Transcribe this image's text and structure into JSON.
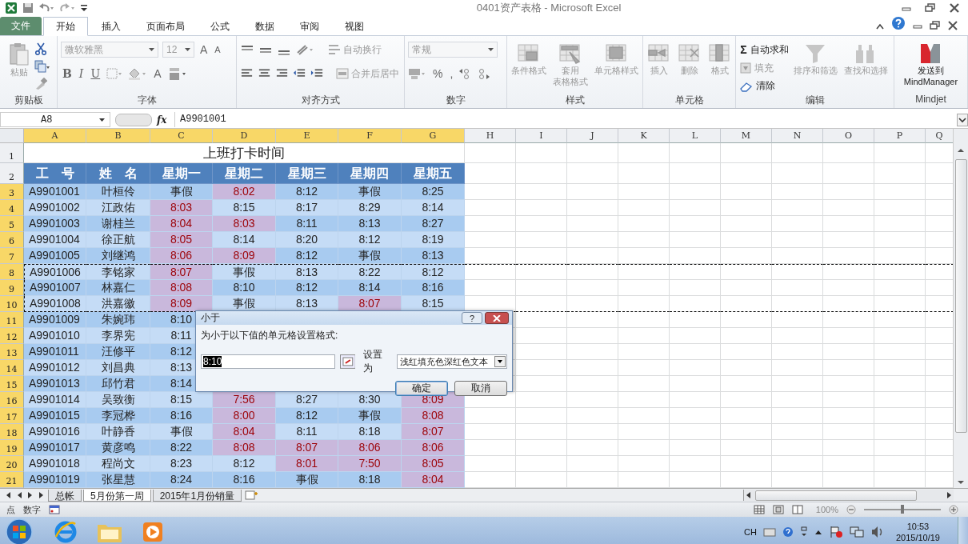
{
  "window": {
    "title": "0401资产表格 - Microsoft Excel"
  },
  "tabs": [
    {
      "label": "文件",
      "kind": "file",
      "selected": false
    },
    {
      "label": "开始",
      "kind": "tab",
      "selected": true
    },
    {
      "label": "插入",
      "kind": "tab",
      "selected": false
    },
    {
      "label": "页面布局",
      "kind": "tab",
      "selected": false
    },
    {
      "label": "公式",
      "kind": "tab",
      "selected": false
    },
    {
      "label": "数据",
      "kind": "tab",
      "selected": false
    },
    {
      "label": "审阅",
      "kind": "tab",
      "selected": false
    },
    {
      "label": "视图",
      "kind": "tab",
      "selected": false
    }
  ],
  "ribbon": {
    "clipboard": {
      "label": "剪贴板",
      "paste": "粘贴"
    },
    "font": {
      "label": "字体",
      "font_name": "微软雅黑",
      "font_size": "12",
      "grow": "A",
      "shrink": "A",
      "bold": "B",
      "italic": "I",
      "underline": "U",
      "font_color": "A"
    },
    "alignment": {
      "label": "对齐方式",
      "wrap": "自动换行",
      "merge": "合并后居中"
    },
    "number": {
      "label": "数字",
      "format": "常规",
      "percent": "%",
      "comma": ","
    },
    "styles": {
      "label": "样式",
      "buttons": [
        {
          "lines": [
            "条件格式"
          ],
          "kind": "conditional",
          "disabled": true
        },
        {
          "lines": [
            "套用",
            "表格格式"
          ],
          "kind": "table",
          "disabled": true
        },
        {
          "lines": [
            "单元格样式"
          ],
          "kind": "cellstyle",
          "disabled": true
        }
      ]
    },
    "cells": {
      "label": "单元格",
      "buttons": [
        {
          "lines": [
            "插入"
          ],
          "kind": "insert",
          "disabled": true
        },
        {
          "lines": [
            "删除"
          ],
          "kind": "delete",
          "disabled": true
        },
        {
          "lines": [
            "格式"
          ],
          "kind": "format",
          "disabled": true
        }
      ]
    },
    "editing": {
      "label": "编辑",
      "small": [
        {
          "kind": "sum",
          "symbol": "Σ",
          "label": "自动求和",
          "disabled": false
        },
        {
          "kind": "fill",
          "label": "填充",
          "disabled": true
        },
        {
          "kind": "clear",
          "label": "清除",
          "disabled": false
        }
      ],
      "buttons": [
        {
          "lines": [
            "排序和筛选"
          ],
          "kind": "sort",
          "disabled": true
        },
        {
          "lines": [
            "查找和选择"
          ],
          "kind": "find",
          "disabled": true
        }
      ]
    },
    "mindjet": {
      "label": "Mindjet",
      "lines": [
        "发送到",
        "MindManager"
      ]
    }
  },
  "formula_bar": {
    "name_box": "A8",
    "fx": "fx",
    "formula": "A9901001"
  },
  "sheet": {
    "columns": [
      {
        "label": "A",
        "selected": true
      },
      {
        "label": "B",
        "selected": true
      },
      {
        "label": "C",
        "selected": true
      },
      {
        "label": "D",
        "selected": true
      },
      {
        "label": "E",
        "selected": true
      },
      {
        "label": "F",
        "selected": true
      },
      {
        "label": "G",
        "selected": true
      },
      {
        "label": "H",
        "selected": false
      },
      {
        "label": "I",
        "selected": false
      },
      {
        "label": "J",
        "selected": false
      },
      {
        "label": "K",
        "selected": false
      },
      {
        "label": "L",
        "selected": false
      },
      {
        "label": "M",
        "selected": false
      },
      {
        "label": "N",
        "selected": false
      },
      {
        "label": "O",
        "selected": false
      },
      {
        "label": "P",
        "selected": false
      },
      {
        "label": "Q",
        "selected": false
      }
    ],
    "title_row": {
      "number": "1",
      "selected": false,
      "text": "上班打卡时间"
    },
    "header_row": {
      "number": "2",
      "selected": false,
      "cells": [
        "工　号",
        "姓　名",
        "星期一",
        "星期二",
        "星期三",
        "星期四",
        "星期五"
      ]
    },
    "rows": [
      {
        "number": "3",
        "selected": true,
        "marquee": false,
        "cells": [
          {
            "text": "A9901001",
            "highlighted": false
          },
          {
            "text": "叶桓伶",
            "highlighted": false
          },
          {
            "text": "事假",
            "highlighted": false
          },
          {
            "text": "8:02",
            "highlighted": true
          },
          {
            "text": "8:12",
            "highlighted": false
          },
          {
            "text": "事假",
            "highlighted": false
          },
          {
            "text": "8:25",
            "highlighted": false
          }
        ]
      },
      {
        "number": "4",
        "selected": true,
        "marquee": false,
        "cells": [
          {
            "text": "A9901002",
            "highlighted": false
          },
          {
            "text": "江政佑",
            "highlighted": false
          },
          {
            "text": "8:03",
            "highlighted": true
          },
          {
            "text": "8:15",
            "highlighted": false
          },
          {
            "text": "8:17",
            "highlighted": false
          },
          {
            "text": "8:29",
            "highlighted": false
          },
          {
            "text": "8:14",
            "highlighted": false
          }
        ]
      },
      {
        "number": "5",
        "selected": true,
        "marquee": false,
        "cells": [
          {
            "text": "A9901003",
            "highlighted": false
          },
          {
            "text": "谢桂兰",
            "highlighted": false
          },
          {
            "text": "8:04",
            "highlighted": true
          },
          {
            "text": "8:03",
            "highlighted": true
          },
          {
            "text": "8:11",
            "highlighted": false
          },
          {
            "text": "8:13",
            "highlighted": false
          },
          {
            "text": "8:27",
            "highlighted": false
          }
        ]
      },
      {
        "number": "6",
        "selected": true,
        "marquee": false,
        "cells": [
          {
            "text": "A9901004",
            "highlighted": false
          },
          {
            "text": "徐正航",
            "highlighted": false
          },
          {
            "text": "8:05",
            "highlighted": true
          },
          {
            "text": "8:14",
            "highlighted": false
          },
          {
            "text": "8:20",
            "highlighted": false
          },
          {
            "text": "8:12",
            "highlighted": false
          },
          {
            "text": "8:19",
            "highlighted": false
          }
        ]
      },
      {
        "number": "7",
        "selected": true,
        "marquee": false,
        "cells": [
          {
            "text": "A9901005",
            "highlighted": false
          },
          {
            "text": "刘继鸿",
            "highlighted": false
          },
          {
            "text": "8:06",
            "highlighted": true
          },
          {
            "text": "8:09",
            "highlighted": true
          },
          {
            "text": "8:12",
            "highlighted": false
          },
          {
            "text": "事假",
            "highlighted": false
          },
          {
            "text": "8:13",
            "highlighted": false
          }
        ]
      },
      {
        "number": "8",
        "selected": true,
        "marquee": true,
        "cells": [
          {
            "text": "A9901006",
            "highlighted": false
          },
          {
            "text": "李铭家",
            "highlighted": false
          },
          {
            "text": "8:07",
            "highlighted": true
          },
          {
            "text": "事假",
            "highlighted": false
          },
          {
            "text": "8:13",
            "highlighted": false
          },
          {
            "text": "8:22",
            "highlighted": false
          },
          {
            "text": "8:12",
            "highlighted": false
          }
        ]
      },
      {
        "number": "9",
        "selected": true,
        "marquee": true,
        "cells": [
          {
            "text": "A9901007",
            "highlighted": false
          },
          {
            "text": "林嘉仁",
            "highlighted": false
          },
          {
            "text": "8:08",
            "highlighted": true
          },
          {
            "text": "8:10",
            "highlighted": false
          },
          {
            "text": "8:12",
            "highlighted": false
          },
          {
            "text": "8:14",
            "highlighted": false
          },
          {
            "text": "8:16",
            "highlighted": false
          }
        ]
      },
      {
        "number": "10",
        "selected": true,
        "marquee": true,
        "cells": [
          {
            "text": "A9901008",
            "highlighted": false
          },
          {
            "text": "洪嘉徽",
            "highlighted": false
          },
          {
            "text": "8:09",
            "highlighted": true
          },
          {
            "text": "事假",
            "highlighted": false
          },
          {
            "text": "8:13",
            "highlighted": false
          },
          {
            "text": "8:07",
            "highlighted": true
          },
          {
            "text": "8:15",
            "highlighted": false
          }
        ]
      },
      {
        "number": "11",
        "selected": true,
        "marquee": false,
        "cells": [
          {
            "text": "A9901009",
            "highlighted": false
          },
          {
            "text": "朱婉玮",
            "highlighted": false
          },
          {
            "text": "8:10",
            "highlighted": false
          }
        ]
      },
      {
        "number": "12",
        "selected": true,
        "marquee": false,
        "cells": [
          {
            "text": "A9901010",
            "highlighted": false
          },
          {
            "text": "李界宪",
            "highlighted": false
          },
          {
            "text": "8:11",
            "highlighted": false
          }
        ]
      },
      {
        "number": "13",
        "selected": true,
        "marquee": false,
        "cells": [
          {
            "text": "A9901011",
            "highlighted": false
          },
          {
            "text": "汪修平",
            "highlighted": false
          },
          {
            "text": "8:12",
            "highlighted": false
          }
        ]
      },
      {
        "number": "14",
        "selected": true,
        "marquee": false,
        "cells": [
          {
            "text": "A9901012",
            "highlighted": false
          },
          {
            "text": "刘昌典",
            "highlighted": false
          },
          {
            "text": "8:13",
            "highlighted": false
          }
        ]
      },
      {
        "number": "15",
        "selected": true,
        "marquee": false,
        "cells": [
          {
            "text": "A9901013",
            "highlighted": false
          },
          {
            "text": "邱竹君",
            "highlighted": false
          },
          {
            "text": "8:14",
            "highlighted": false
          }
        ]
      },
      {
        "number": "16",
        "selected": true,
        "marquee": false,
        "cells": [
          {
            "text": "A9901014",
            "highlighted": false
          },
          {
            "text": "吴致衡",
            "highlighted": false
          },
          {
            "text": "8:15",
            "highlighted": false
          },
          {
            "text": "7:56",
            "highlighted": true
          },
          {
            "text": "8:27",
            "highlighted": false
          },
          {
            "text": "8:30",
            "highlighted": false
          },
          {
            "text": "8:09",
            "highlighted": true
          }
        ]
      },
      {
        "number": "17",
        "selected": true,
        "marquee": false,
        "cells": [
          {
            "text": "A9901015",
            "highlighted": false
          },
          {
            "text": "李冠桦",
            "highlighted": false
          },
          {
            "text": "8:16",
            "highlighted": false
          },
          {
            "text": "8:00",
            "highlighted": true
          },
          {
            "text": "8:12",
            "highlighted": false
          },
          {
            "text": "事假",
            "highlighted": false
          },
          {
            "text": "8:08",
            "highlighted": true
          }
        ]
      },
      {
        "number": "18",
        "selected": true,
        "marquee": false,
        "cells": [
          {
            "text": "A9901016",
            "highlighted": false
          },
          {
            "text": "叶静香",
            "highlighted": false
          },
          {
            "text": "事假",
            "highlighted": false
          },
          {
            "text": "8:04",
            "highlighted": true
          },
          {
            "text": "8:11",
            "highlighted": false
          },
          {
            "text": "8:18",
            "highlighted": false
          },
          {
            "text": "8:07",
            "highlighted": true
          }
        ]
      },
      {
        "number": "19",
        "selected": true,
        "marquee": false,
        "cells": [
          {
            "text": "A9901017",
            "highlighted": false
          },
          {
            "text": "黄彦鸣",
            "highlighted": false
          },
          {
            "text": "8:22",
            "highlighted": false
          },
          {
            "text": "8:08",
            "highlighted": true
          },
          {
            "text": "8:07",
            "highlighted": true
          },
          {
            "text": "8:06",
            "highlighted": true
          },
          {
            "text": "8:06",
            "highlighted": true
          }
        ]
      },
      {
        "number": "20",
        "selected": true,
        "marquee": false,
        "cells": [
          {
            "text": "A9901018",
            "highlighted": false
          },
          {
            "text": "程尚文",
            "highlighted": false
          },
          {
            "text": "8:23",
            "highlighted": false
          },
          {
            "text": "8:12",
            "highlighted": false
          },
          {
            "text": "8:01",
            "highlighted": true
          },
          {
            "text": "7:50",
            "highlighted": true
          },
          {
            "text": "8:05",
            "highlighted": true
          }
        ]
      },
      {
        "number": "21",
        "selected": true,
        "marquee": false,
        "cells": [
          {
            "text": "A9901019",
            "highlighted": false
          },
          {
            "text": "张星慧",
            "highlighted": false
          },
          {
            "text": "8:24",
            "highlighted": false
          },
          {
            "text": "8:16",
            "highlighted": false
          },
          {
            "text": "事假",
            "highlighted": false
          },
          {
            "text": "8:18",
            "highlighted": false
          },
          {
            "text": "8:04",
            "highlighted": true
          }
        ]
      }
    ]
  },
  "dialog": {
    "title": "小于",
    "help": "?",
    "prompt": "为小于以下值的单元格设置格式:",
    "value": "8:10",
    "set_label": "设置为",
    "format": "浅红填充色深红色文本",
    "ok": "确定",
    "cancel": "取消"
  },
  "sheet_tabs": [
    {
      "label": "总帐",
      "selected": false
    },
    {
      "label": "5月份第一周",
      "selected": true
    },
    {
      "label": "2015年1月份销量",
      "selected": false
    }
  ],
  "status_bar": {
    "mode": "点",
    "num": "数字",
    "zoom": "100%",
    "level": 0.5
  },
  "taskbar": {
    "lang": "CH",
    "time": "10:53",
    "date": "2015/10/19"
  }
}
